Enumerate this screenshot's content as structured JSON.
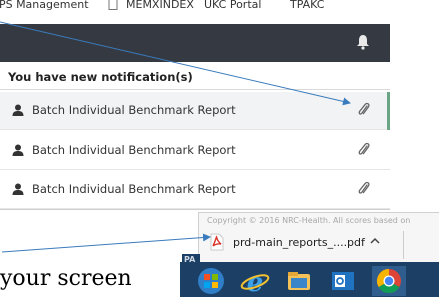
{
  "bookmarks": [
    {
      "label": "EPS Management",
      "icon": "folder-icon"
    },
    {
      "label": "MEMXINDEX",
      "icon": "page-icon"
    },
    {
      "label": "UKC Portal",
      "icon": "page-icon"
    },
    {
      "label": "TPAKC",
      "icon": "page-icon"
    }
  ],
  "header": {
    "bell_icon": "bell-icon"
  },
  "notifications": {
    "heading": "You have new notification(s)",
    "items": [
      {
        "label": "Batch Individual Benchmark Report"
      },
      {
        "label": "Batch Individual Benchmark Report"
      },
      {
        "label": "Batch Individual Benchmark Report"
      }
    ]
  },
  "downloads": {
    "faded_text": "Copyright © 2016 NRC-Health. All scores based on",
    "file_name": "prd-main_reports_....pdf"
  },
  "page_text": "your screen",
  "taskbar": {
    "pa_label": "PA",
    "icons": [
      "windows-start-icon",
      "internet-explorer-icon",
      "file-explorer-icon",
      "outlook-icon",
      "chrome-icon"
    ]
  },
  "colors": {
    "header": "#353a42",
    "taskbar": "#1c3f66",
    "arrow": "#3a7bbd",
    "pdf": "#d9342b"
  }
}
